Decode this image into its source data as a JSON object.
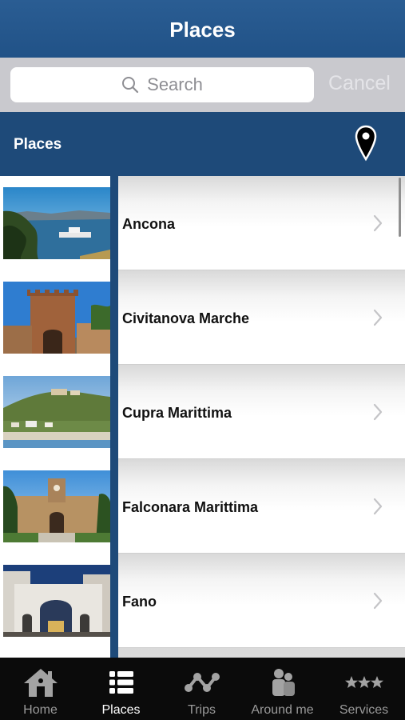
{
  "header": {
    "title": "Places"
  },
  "search": {
    "placeholder": "Search",
    "cancel_label": "Cancel"
  },
  "section": {
    "title": "Places",
    "map_icon": "map-pin-icon"
  },
  "places": [
    {
      "name": "Ancona",
      "image": "harbor-city-photo"
    },
    {
      "name": "Civitanova Marche",
      "image": "brick-tower-photo"
    },
    {
      "name": "Cupra Marittima",
      "image": "hill-town-beach-photo"
    },
    {
      "name": "Falconara Marittima",
      "image": "castle-gate-photo"
    },
    {
      "name": "Fano",
      "image": "roman-arch-photo"
    }
  ],
  "tabbar": {
    "tabs": [
      {
        "label": "Home",
        "icon": "home-icon",
        "active": false
      },
      {
        "label": "Places",
        "icon": "list-icon",
        "active": true
      },
      {
        "label": "Trips",
        "icon": "route-icon",
        "active": false
      },
      {
        "label": "Around me",
        "icon": "people-icon",
        "active": false
      },
      {
        "label": "Services",
        "icon": "stars-icon",
        "active": false
      }
    ]
  },
  "colors": {
    "nav": "#215287",
    "section": "#1e4a79",
    "tabbar": "#0b0b0b"
  }
}
